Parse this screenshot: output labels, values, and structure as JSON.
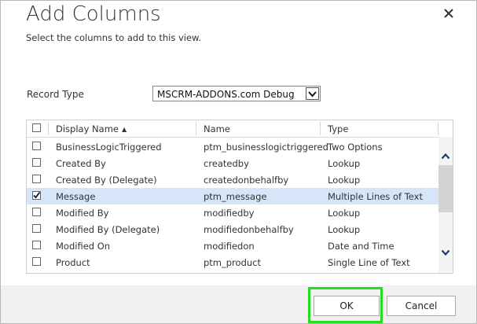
{
  "dialog": {
    "title": "Add Columns",
    "subtitle": "Select the columns to add to this view."
  },
  "record_type": {
    "label": "Record Type",
    "selected": "MSCRM-ADDONS.com Debug"
  },
  "grid": {
    "columns": [
      "Display Name",
      "Name",
      "Type"
    ],
    "sort_indicator": "▲",
    "rows": [
      {
        "display": "BusinessLogicTriggered",
        "name": "ptm_businesslogictriggered",
        "type": "Two Options",
        "checked": false
      },
      {
        "display": "Created By",
        "name": "createdby",
        "type": "Lookup",
        "checked": false
      },
      {
        "display": "Created By (Delegate)",
        "name": "createdonbehalfby",
        "type": "Lookup",
        "checked": false
      },
      {
        "display": "Message",
        "name": "ptm_message",
        "type": "Multiple Lines of Text",
        "checked": true
      },
      {
        "display": "Modified By",
        "name": "modifiedby",
        "type": "Lookup",
        "checked": false
      },
      {
        "display": "Modified By (Delegate)",
        "name": "modifiedonbehalfby",
        "type": "Lookup",
        "checked": false
      },
      {
        "display": "Modified On",
        "name": "modifiedon",
        "type": "Date and Time",
        "checked": false
      },
      {
        "display": "Product",
        "name": "ptm_product",
        "type": "Single Line of Text",
        "checked": false
      }
    ]
  },
  "buttons": {
    "ok": "OK",
    "cancel": "Cancel"
  },
  "colors": {
    "selected_row": "#d6e6f8",
    "highlight": "#22dd22",
    "footer": "#f1f1f1"
  },
  "icons": {
    "close": "close-icon",
    "dropdown": "chevron-down-icon",
    "scroll_up": "chevron-up-icon",
    "scroll_down": "chevron-down-icon",
    "check": "check-icon"
  }
}
